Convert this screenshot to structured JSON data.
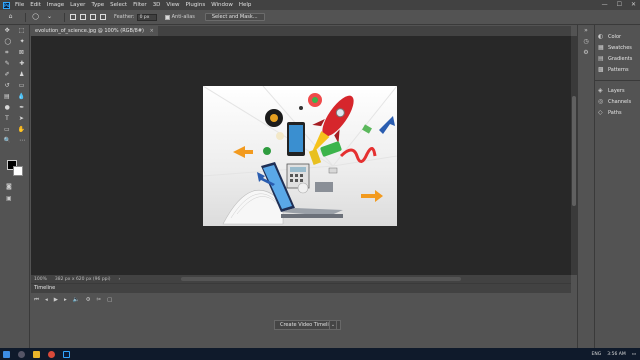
{
  "app": {
    "logo": "Ps"
  },
  "menu": [
    "File",
    "Edit",
    "Image",
    "Layer",
    "Type",
    "Select",
    "Filter",
    "3D",
    "View",
    "Plugins",
    "Window",
    "Help"
  ],
  "window_controls": {
    "minimize": "—",
    "maximize": "☐",
    "close": "✕"
  },
  "options": {
    "feather_label": "Feather:",
    "feather_value": "0 px",
    "anti_alias_label": "Anti-alias",
    "select_mask_label": "Select and Mask..."
  },
  "document": {
    "tab_title": "evolution_of_science.jpg @ 100% (RGB/8#)",
    "tab_close": "×"
  },
  "status": {
    "zoom": "100%",
    "dimensions": "382 px x 620 px (96 ppi)",
    "arrow": "›"
  },
  "timeline": {
    "title": "Timeline",
    "create_button": "Create Video Timeline",
    "dropdown": "⌄"
  },
  "panels": {
    "group1": [
      {
        "icon": "palette-icon",
        "label": "Color",
        "glyph": "◐"
      },
      {
        "icon": "swatches-icon",
        "label": "Swatches",
        "glyph": "▦"
      },
      {
        "icon": "gradients-icon",
        "label": "Gradients",
        "glyph": "▤"
      },
      {
        "icon": "patterns-icon",
        "label": "Patterns",
        "glyph": "▩"
      }
    ],
    "group2": [
      {
        "icon": "layers-icon",
        "label": "Layers",
        "glyph": "◈"
      },
      {
        "icon": "channels-icon",
        "label": "Channels",
        "glyph": "◎"
      },
      {
        "icon": "paths-icon",
        "label": "Paths",
        "glyph": "◇"
      }
    ]
  },
  "taskbar": {
    "time": "3:56 AM",
    "language": "ENG"
  },
  "colors": {
    "foreground": "#000000",
    "background": "#ffffff",
    "accent": "#31a8ff"
  }
}
